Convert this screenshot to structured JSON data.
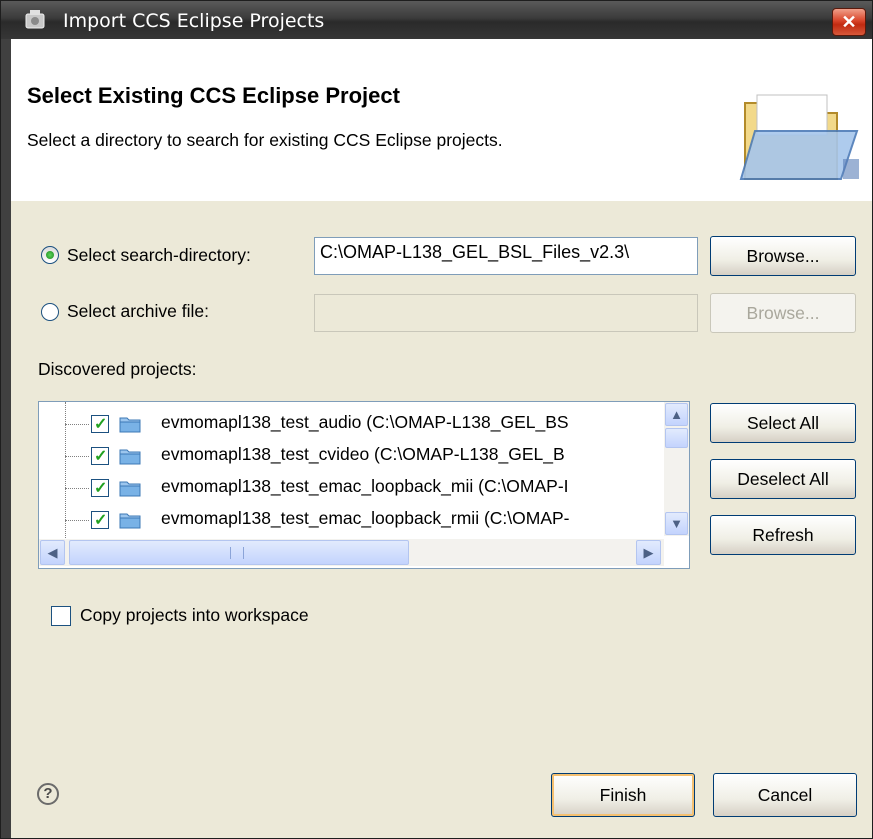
{
  "window": {
    "title": "Import CCS Eclipse Projects",
    "close": "✕"
  },
  "header": {
    "title": "Select Existing CCS Eclipse Project",
    "description": "Select a directory to search for existing CCS Eclipse projects."
  },
  "search_directory": {
    "label": "Select search-directory:",
    "value": "C:\\OMAP-L138_GEL_BSL_Files_v2.3\\",
    "selected": true,
    "browse": "Browse..."
  },
  "archive_file": {
    "label": "Select archive file:",
    "value": "",
    "selected": false,
    "browse": "Browse..."
  },
  "discovered": {
    "label": "Discovered projects:",
    "projects": [
      {
        "text": "evmomapl138_test_audio  (C:\\OMAP-L138_GEL_BS",
        "checked": true
      },
      {
        "text": "evmomapl138_test_cvideo  (C:\\OMAP-L138_GEL_B",
        "checked": true
      },
      {
        "text": "evmomapl138_test_emac_loopback_mii  (C:\\OMAP-I",
        "checked": true
      },
      {
        "text": "evmomapl138_test_emac_loopback_rmii  (C:\\OMAP-",
        "checked": true
      }
    ],
    "select_all": "Select All",
    "deselect_all": "Deselect All",
    "refresh": "Refresh"
  },
  "copy_projects": {
    "label": "Copy projects into workspace",
    "checked": false
  },
  "footer": {
    "help": "?",
    "finish": "Finish",
    "cancel": "Cancel"
  },
  "colors": {
    "accent": "#21a121",
    "title_bar": "#3b3b3b",
    "close": "#c22a10"
  }
}
